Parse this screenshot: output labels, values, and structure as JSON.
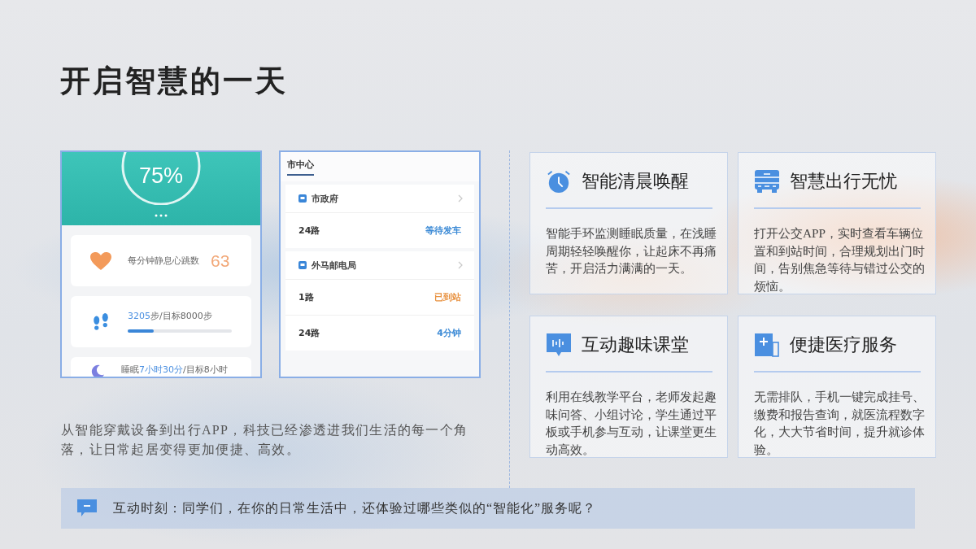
{
  "title": "开启智慧的一天",
  "health_app": {
    "ring_reading": "75%",
    "metrics": [
      {
        "kind": "heart",
        "parts": [
          {
            "text": "每分钟静息心跳数",
            "highlight": false
          }
        ],
        "value": "63"
      },
      {
        "kind": "steps",
        "parts": [
          {
            "text": "3205",
            "highlight": true
          },
          {
            "text": "步/目标8000步",
            "highlight": false
          }
        ],
        "level": 0.25
      },
      {
        "kind": "sleep",
        "parts": [
          {
            "text": "睡眠",
            "highlight": false
          },
          {
            "text": "7小时30分",
            "highlight": true
          },
          {
            "text": "/目标8小时",
            "highlight": false
          }
        ]
      }
    ]
  },
  "bus_app": {
    "tabs": [
      {
        "label": "市中心",
        "selected": true
      }
    ],
    "stops": [
      {
        "name": "市政府",
        "routes": [
          {
            "route": "24路",
            "status": "等待发车",
            "color": "#3d8bd6"
          }
        ]
      },
      {
        "name": "外马邮电局",
        "routes": [
          {
            "route": "1路",
            "status": "已到站",
            "color": "#e8913f"
          },
          {
            "route": "24路",
            "status": "4分钟",
            "color": "#3d8bd6"
          }
        ]
      }
    ]
  },
  "intro": "从智能穿戴设备到出行APP，科技已经渗透进我们生活的每一个角落，让日常起居变得更加便捷、高效。",
  "features": [
    {
      "kind": "alarm",
      "title": "智能清晨唤醒",
      "body": "智能手环监测睡眠质量，在浅睡周期轻轻唤醒你，让起床不再痛苦，开启活力满满的一天。"
    },
    {
      "kind": "bus",
      "title": "智慧出行无忧",
      "body": "打开公交APP，实时查看车辆位置和到站时间，合理规划出门时间，告别焦急等待与错过公交的烦恼。"
    },
    {
      "kind": "classroom",
      "title": "互动趣味课堂",
      "body": "利用在线教学平台，老师发起趣味问答、小组讨论，学生通过平板或手机参与互动，让课堂更生动高效。"
    },
    {
      "kind": "medical",
      "title": "便捷医疗服务",
      "body": "无需排队，手机一键完成挂号、缴费和报告查询，就医流程数字化，大大节省时间，提升就诊体验。"
    }
  ],
  "prompt": {
    "text": "互动时刻：同学们，在你的日常生活中，还体验过哪些类似的“智能化”服务呢？"
  }
}
